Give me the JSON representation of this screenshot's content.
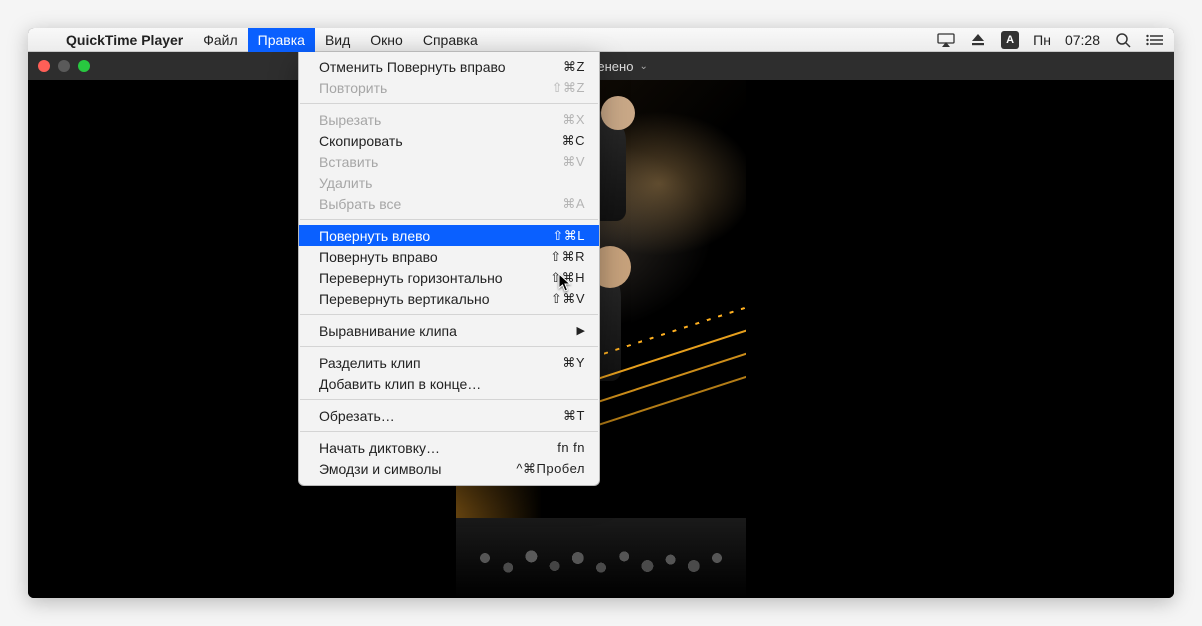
{
  "app_name": "QuickTime Player",
  "menubar": {
    "items": [
      "Файл",
      "Правка",
      "Вид",
      "Окно",
      "Справка"
    ],
    "active_index": 1
  },
  "status": {
    "lang_key": "A",
    "day": "Пн",
    "time": "07:28"
  },
  "window": {
    "title_suffix": "Изменено"
  },
  "dropdown": {
    "groups": [
      [
        {
          "label": "Отменить Повернуть вправо",
          "shortcut": "⌘Z",
          "enabled": true
        },
        {
          "label": "Повторить",
          "shortcut": "⇧⌘Z",
          "enabled": false
        }
      ],
      [
        {
          "label": "Вырезать",
          "shortcut": "⌘X",
          "enabled": false
        },
        {
          "label": "Скопировать",
          "shortcut": "⌘C",
          "enabled": true
        },
        {
          "label": "Вставить",
          "shortcut": "⌘V",
          "enabled": false
        },
        {
          "label": "Удалить",
          "shortcut": "",
          "enabled": false
        },
        {
          "label": "Выбрать все",
          "shortcut": "⌘A",
          "enabled": false
        }
      ],
      [
        {
          "label": "Повернуть влево",
          "shortcut": "⇧⌘L",
          "enabled": true,
          "highlighted": true
        },
        {
          "label": "Повернуть вправо",
          "shortcut": "⇧⌘R",
          "enabled": true
        },
        {
          "label": "Перевернуть горизонтально",
          "shortcut": "⇧⌘H",
          "enabled": true
        },
        {
          "label": "Перевернуть вертикально",
          "shortcut": "⇧⌘V",
          "enabled": true
        }
      ],
      [
        {
          "label": "Выравнивание клипа",
          "shortcut": "",
          "enabled": true,
          "submenu": true
        }
      ],
      [
        {
          "label": "Разделить клип",
          "shortcut": "⌘Y",
          "enabled": true
        },
        {
          "label": "Добавить клип в конце…",
          "shortcut": "",
          "enabled": true
        }
      ],
      [
        {
          "label": "Обрезать…",
          "shortcut": "⌘T",
          "enabled": true
        }
      ],
      [
        {
          "label": "Начать диктовку…",
          "shortcut": "fn fn",
          "enabled": true
        },
        {
          "label": "Эмодзи и символы",
          "shortcut": "^⌘Пробел",
          "enabled": true
        }
      ]
    ]
  }
}
